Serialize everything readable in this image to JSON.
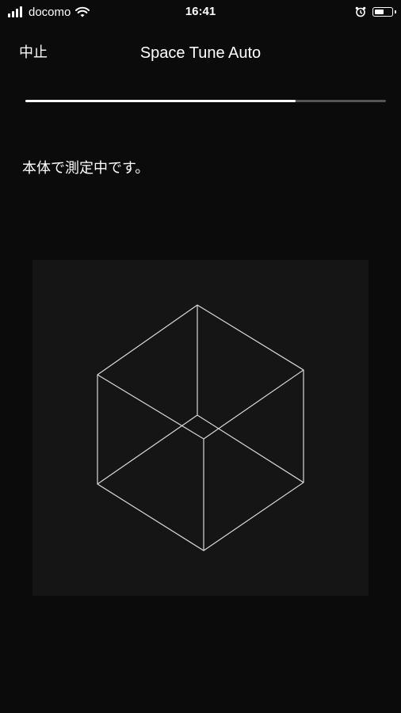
{
  "status_bar": {
    "carrier": "docomo",
    "time": "16:41",
    "battery_level": 0.55,
    "icons": [
      "signal-icon",
      "wifi-icon",
      "alarm-icon",
      "battery-icon"
    ]
  },
  "nav": {
    "cancel_label": "中止",
    "title": "Space Tune Auto"
  },
  "progress": {
    "value": 0.75
  },
  "main": {
    "message": "本体で測定中です。",
    "illustration": "cube-wireframe-icon"
  },
  "colors": {
    "background": "#0b0b0b",
    "panel": "#151515",
    "progress_fill": "#ffffff",
    "progress_track": "#555555"
  }
}
